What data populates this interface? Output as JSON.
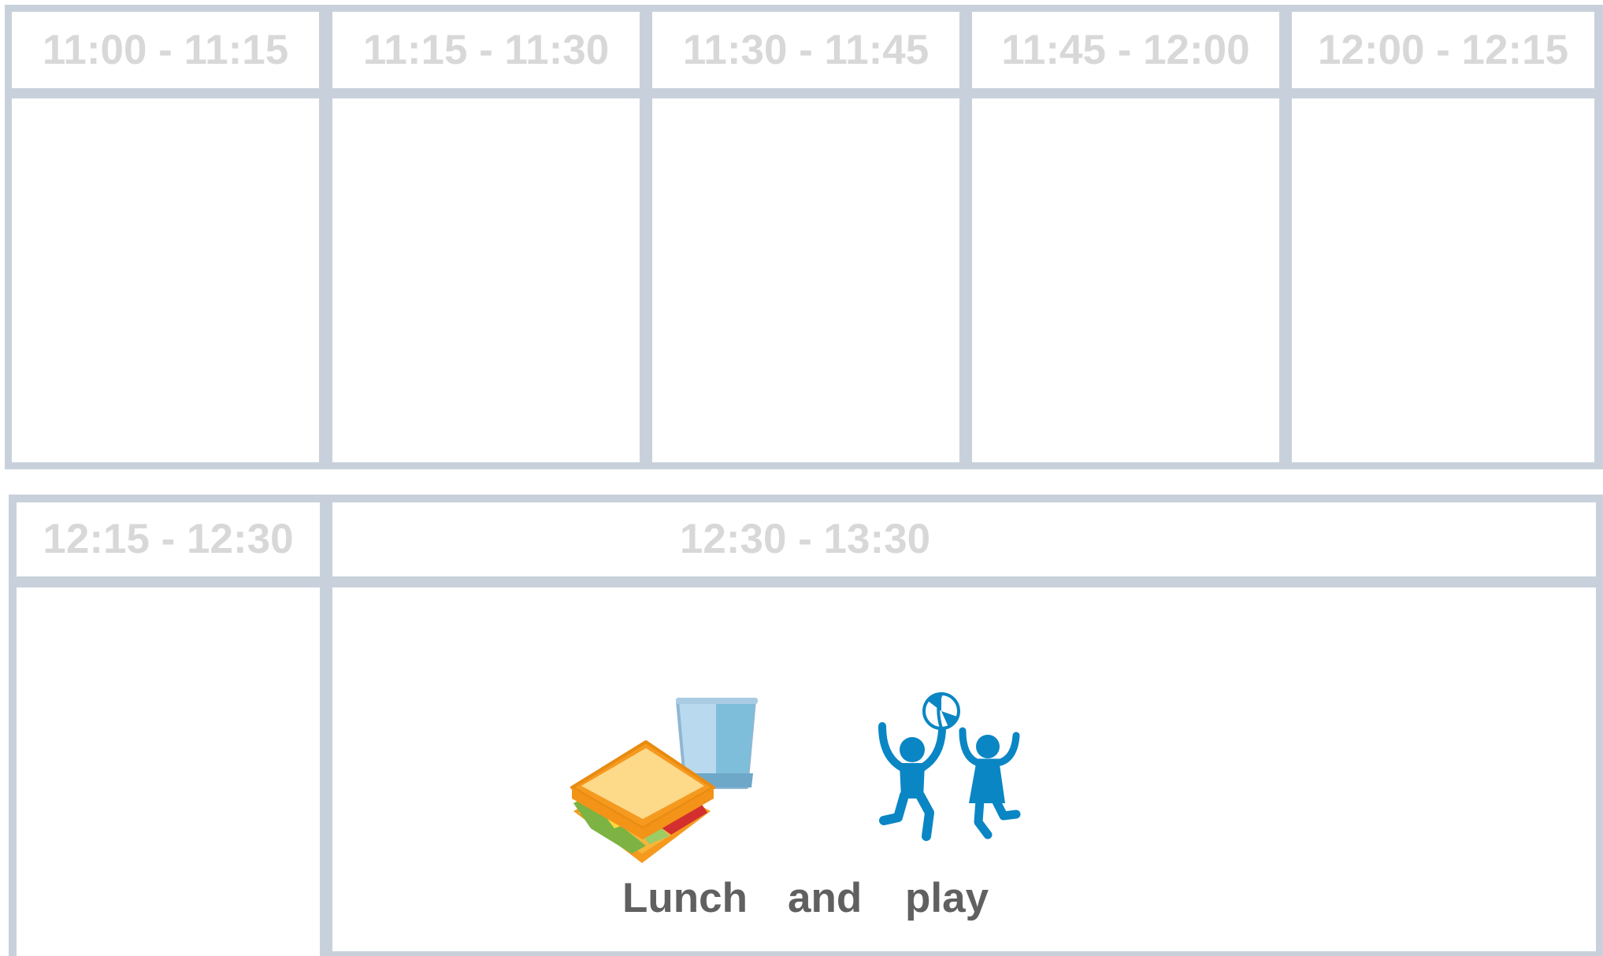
{
  "schedule": {
    "row1": {
      "slots": [
        {
          "time": "11:00 - 11:15",
          "activity": ""
        },
        {
          "time": "11:15 - 11:30",
          "activity": ""
        },
        {
          "time": "11:30 - 11:45",
          "activity": ""
        },
        {
          "time": "11:45 - 12:00",
          "activity": ""
        },
        {
          "time": "12:00 - 12:15",
          "activity": ""
        }
      ]
    },
    "row2": {
      "slots": [
        {
          "time": "12:15 - 12:30",
          "activity": ""
        },
        {
          "time": "12:30 - 13:30",
          "caption": {
            "word1": "Lunch",
            "word2": "and",
            "word3": "play"
          },
          "icons": [
            "sandwich-icon",
            "glass-of-water-icon",
            "beach-ball-icon",
            "children-playing-icon"
          ]
        }
      ]
    }
  },
  "colors": {
    "grid": "#c8d1db",
    "time_text": "#d8d8d8",
    "caption_text": "#606060",
    "pictogram_blue": "#0a86c4"
  }
}
